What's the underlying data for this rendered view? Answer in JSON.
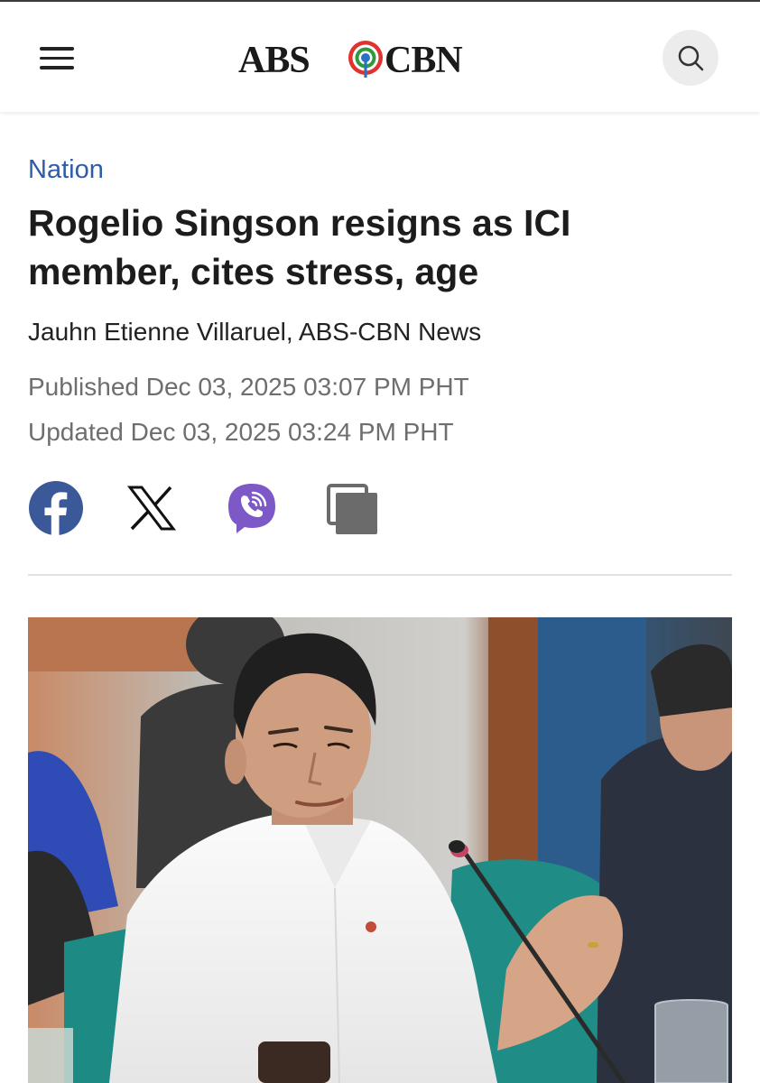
{
  "header": {
    "logo_text": "ABS-CBN",
    "menu_icon": "hamburger-icon",
    "search_icon": "search-icon"
  },
  "article": {
    "category": "Nation",
    "headline": "Rogelio Singson resigns as ICI member, cites stress, age",
    "author": "Jauhn Etienne Villaruel, ABS-CBN News",
    "published": "Published Dec 03, 2025 03:07 PM PHT",
    "updated": "Updated Dec 03, 2025 03:24 PM PHT"
  },
  "share": {
    "items": [
      "facebook-icon",
      "x-icon",
      "viber-icon",
      "copy-link-icon"
    ]
  },
  "colors": {
    "category": "#2e5ca8",
    "facebook": "#3b5998",
    "viber": "#7d59c8",
    "copy": "#6b6b6b"
  }
}
